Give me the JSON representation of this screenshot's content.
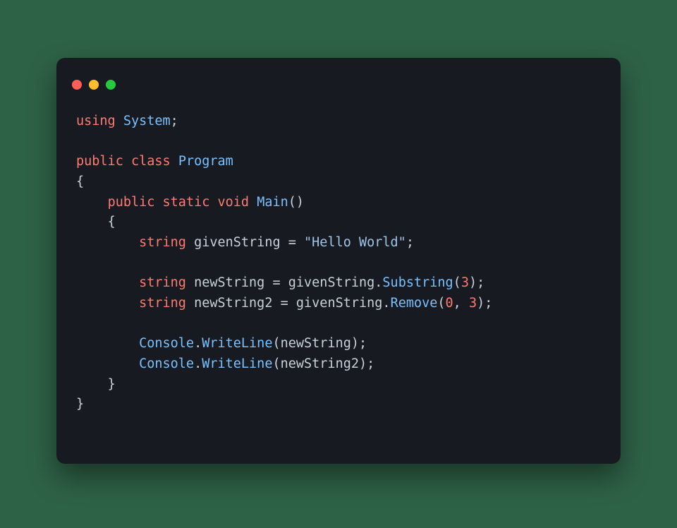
{
  "code": {
    "l1": {
      "kw_using": "using",
      "ns": "System",
      "semi": ";"
    },
    "l3": {
      "kw_public": "public",
      "kw_class": "class",
      "name": "Program"
    },
    "l4": {
      "brace": "{"
    },
    "l5": {
      "kw_public": "public",
      "kw_static": "static",
      "kw_void": "void",
      "fn": "Main",
      "paren": "()"
    },
    "l6": {
      "brace": "{"
    },
    "l7": {
      "kw_string": "string",
      "id": "givenString",
      "eq": "=",
      "str": "\"Hello World\"",
      "semi": ";"
    },
    "l9": {
      "kw_string": "string",
      "id": "newString",
      "eq": "=",
      "src": "givenString",
      "dot": ".",
      "fn": "Substring",
      "open": "(",
      "n0": "3",
      "close": ")",
      "semi": ";"
    },
    "l10": {
      "kw_string": "string",
      "id": "newString2",
      "eq": "=",
      "src": "givenString",
      "dot": ".",
      "fn": "Remove",
      "open": "(",
      "n0": "0",
      "comma": ",",
      "n1": "3",
      "close": ")",
      "semi": ";"
    },
    "l12": {
      "obj": "Console",
      "dot": ".",
      "fn": "WriteLine",
      "open": "(",
      "arg": "newString",
      "close": ")",
      "semi": ";"
    },
    "l13": {
      "obj": "Console",
      "dot": ".",
      "fn": "WriteLine",
      "open": "(",
      "arg": "newString2",
      "close": ")",
      "semi": ";"
    },
    "l14": {
      "brace": "}"
    },
    "l15": {
      "brace": "}"
    }
  }
}
